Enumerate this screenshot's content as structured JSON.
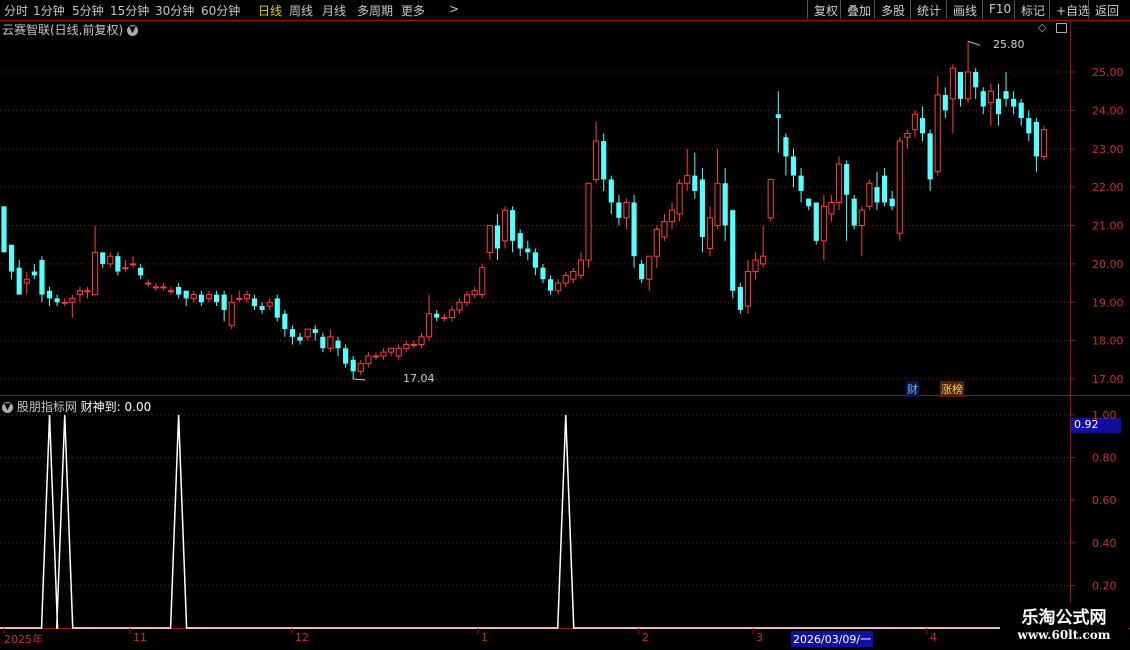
{
  "toolbar": {
    "left_items": [
      "分时",
      "1分钟",
      "5分钟",
      "15分钟",
      "30分钟",
      "60分钟",
      "日线",
      "周线",
      "月线",
      "多周期",
      "更多"
    ],
    "active_index": 6,
    "more_arrow": ">",
    "right_buttons": [
      "复权",
      "叠加",
      "多股",
      "统计",
      "画线",
      "F10",
      "标记",
      "+自选",
      "返回"
    ]
  },
  "main_panel": {
    "title": "云赛智联(日线,前复权)",
    "high_label": "25.80",
    "low_label": "17.04",
    "badge_cai": "财",
    "badge_zhangbang": "涨榜",
    "y_ticks": [
      "25.00",
      "24.00",
      "23.00",
      "22.00",
      "21.00",
      "20.00",
      "19.00",
      "18.00",
      "17.00"
    ]
  },
  "indicator_panel": {
    "title": "股朋指标网",
    "series_label": "财神到:",
    "series_value": "0.00",
    "current_value": "0.92",
    "y_ticks": [
      "1.00",
      "0.80",
      "0.60",
      "0.40",
      "0.20"
    ]
  },
  "x_axis": {
    "labels": [
      "2025年",
      "11",
      "12",
      "1",
      "2",
      "3",
      "4"
    ],
    "cursor_date": "2026/03/09/一"
  },
  "watermark": {
    "line1": "乐淘公式网",
    "line2": "www.60lt.com"
  },
  "colors": {
    "up": "#ff3c3c",
    "down": "#54ffff",
    "grid": "#a01010",
    "line": "#ffffff",
    "active": "#e0d000"
  },
  "chart_data": [
    {
      "type": "candlestick",
      "title": "云赛智联(日线,前复权)",
      "ylim": [
        16.7,
        26.3
      ],
      "high_annotation": 25.8,
      "low_annotation": 17.04,
      "candles": [
        [
          21.5,
          20.3,
          21.0,
          20.5
        ],
        [
          20.5,
          19.8,
          19.6,
          19.9
        ],
        [
          19.9,
          19.2,
          19.4,
          20.1
        ],
        [
          19.5,
          19.6,
          19.2,
          19.8
        ],
        [
          19.8,
          19.7,
          19.6,
          20.0
        ],
        [
          20.1,
          19.2,
          19.0,
          20.2
        ],
        [
          19.3,
          19.1,
          18.9,
          19.4
        ],
        [
          19.1,
          19.0,
          18.9,
          19.2
        ],
        [
          19.0,
          19.0,
          18.9,
          19.1
        ],
        [
          19.0,
          19.1,
          18.6,
          19.2
        ],
        [
          19.2,
          19.3,
          19.0,
          19.4
        ],
        [
          19.3,
          19.3,
          19.1,
          19.4
        ],
        [
          19.2,
          20.3,
          19.2,
          21.0
        ],
        [
          20.3,
          20.0,
          19.9,
          20.3
        ],
        [
          20.0,
          20.2,
          19.9,
          20.3
        ],
        [
          20.2,
          19.8,
          19.7,
          20.3
        ],
        [
          19.9,
          19.9,
          19.8,
          20.1
        ],
        [
          20.0,
          20.0,
          19.9,
          20.2
        ],
        [
          19.9,
          19.7,
          19.6,
          20.0
        ],
        [
          19.5,
          19.5,
          19.4,
          19.6
        ],
        [
          19.4,
          19.4,
          19.3,
          19.5
        ],
        [
          19.4,
          19.4,
          19.3,
          19.5
        ],
        [
          19.3,
          19.3,
          19.2,
          19.4
        ],
        [
          19.4,
          19.2,
          19.1,
          19.5
        ],
        [
          19.3,
          19.1,
          18.9,
          19.3
        ],
        [
          19.1,
          19.2,
          19.0,
          19.3
        ],
        [
          19.2,
          19.0,
          18.9,
          19.3
        ],
        [
          19.1,
          19.2,
          19.0,
          19.3
        ],
        [
          19.2,
          19.0,
          18.9,
          19.3
        ],
        [
          19.2,
          18.8,
          18.5,
          19.3
        ],
        [
          18.4,
          19.0,
          18.3,
          19.2
        ],
        [
          19.1,
          19.1,
          19.0,
          19.3
        ],
        [
          19.1,
          19.2,
          19.0,
          19.3
        ],
        [
          19.1,
          18.9,
          18.8,
          19.2
        ],
        [
          18.9,
          18.8,
          18.7,
          19.0
        ],
        [
          18.9,
          19.0,
          18.8,
          19.1
        ],
        [
          19.1,
          18.6,
          18.5,
          19.2
        ],
        [
          18.7,
          18.3,
          18.1,
          18.8
        ],
        [
          18.3,
          18.1,
          17.9,
          18.4
        ],
        [
          18.1,
          18.0,
          17.9,
          18.2
        ],
        [
          18.1,
          18.3,
          18.0,
          18.3
        ],
        [
          18.3,
          18.2,
          18.0,
          18.4
        ],
        [
          18.1,
          17.8,
          17.7,
          18.2
        ],
        [
          17.8,
          18.1,
          17.7,
          18.3
        ],
        [
          18.0,
          17.8,
          17.6,
          18.1
        ],
        [
          17.8,
          17.4,
          17.3,
          17.9
        ],
        [
          17.5,
          17.2,
          17.0,
          17.6
        ],
        [
          17.2,
          17.4,
          17.1,
          17.5
        ],
        [
          17.4,
          17.6,
          17.3,
          17.7
        ],
        [
          17.6,
          17.6,
          17.5,
          17.7
        ],
        [
          17.6,
          17.7,
          17.5,
          17.8
        ],
        [
          17.7,
          17.8,
          17.6,
          17.8
        ],
        [
          17.6,
          17.8,
          17.5,
          17.9
        ],
        [
          17.8,
          17.9,
          17.7,
          18.0
        ],
        [
          17.9,
          17.9,
          17.8,
          18.0
        ],
        [
          17.9,
          18.1,
          17.8,
          18.2
        ],
        [
          18.1,
          18.7,
          18.0,
          19.2
        ],
        [
          18.7,
          18.6,
          18.5,
          18.8
        ],
        [
          18.6,
          18.6,
          18.5,
          18.7
        ],
        [
          18.6,
          18.8,
          18.5,
          18.9
        ],
        [
          18.8,
          19.0,
          18.7,
          19.1
        ],
        [
          19.0,
          19.2,
          18.9,
          19.3
        ],
        [
          19.2,
          19.3,
          19.1,
          19.4
        ],
        [
          19.2,
          19.9,
          19.1,
          20.0
        ],
        [
          20.3,
          21.0,
          20.1,
          21.0
        ],
        [
          21.0,
          20.4,
          20.1,
          21.3
        ],
        [
          20.6,
          21.4,
          20.4,
          21.5
        ],
        [
          21.4,
          20.6,
          20.3,
          21.5
        ],
        [
          20.8,
          20.4,
          20.2,
          20.9
        ],
        [
          20.4,
          20.3,
          20.1,
          20.6
        ],
        [
          20.3,
          19.9,
          19.7,
          20.4
        ],
        [
          19.9,
          19.6,
          19.5,
          20.0
        ],
        [
          19.6,
          19.3,
          19.2,
          19.7
        ],
        [
          19.3,
          19.5,
          19.2,
          19.6
        ],
        [
          19.5,
          19.7,
          19.4,
          19.8
        ],
        [
          19.6,
          19.8,
          19.5,
          19.9
        ],
        [
          19.7,
          20.1,
          19.6,
          20.3
        ],
        [
          20.1,
          22.1,
          19.9,
          22.1
        ],
        [
          22.2,
          23.2,
          22.1,
          23.7
        ],
        [
          23.2,
          22.2,
          21.9,
          23.4
        ],
        [
          22.2,
          21.6,
          21.3,
          22.3
        ],
        [
          21.6,
          21.2,
          21.0,
          21.8
        ],
        [
          21.2,
          21.6,
          20.9,
          21.7
        ],
        [
          21.6,
          20.2,
          19.9,
          21.8
        ],
        [
          20.0,
          19.6,
          19.5,
          20.1
        ],
        [
          19.6,
          20.2,
          19.3,
          20.2
        ],
        [
          20.2,
          20.9,
          19.9,
          21.0
        ],
        [
          20.7,
          21.1,
          20.6,
          21.3
        ],
        [
          21.1,
          21.4,
          20.9,
          21.6
        ],
        [
          21.3,
          22.1,
          21.1,
          22.2
        ],
        [
          22.1,
          22.3,
          21.9,
          23.0
        ],
        [
          22.3,
          21.9,
          21.7,
          22.9
        ],
        [
          22.2,
          20.7,
          20.3,
          22.5
        ],
        [
          20.4,
          21.2,
          20.2,
          21.5
        ],
        [
          21.0,
          22.1,
          20.9,
          23.0
        ],
        [
          22.1,
          21.0,
          20.6,
          22.5
        ],
        [
          21.4,
          19.3,
          19.1,
          21.4
        ],
        [
          19.4,
          18.8,
          18.7,
          19.5
        ],
        [
          18.9,
          19.8,
          18.7,
          20.1
        ],
        [
          19.8,
          20.1,
          19.6,
          20.3
        ],
        [
          20.0,
          20.2,
          19.9,
          21.0
        ],
        [
          21.2,
          22.2,
          21.1,
          22.2
        ],
        [
          23.9,
          23.8,
          22.9,
          24.5
        ],
        [
          23.3,
          22.8,
          22.3,
          23.4
        ],
        [
          22.8,
          22.3,
          22.0,
          23.0
        ],
        [
          22.3,
          21.9,
          21.6,
          22.5
        ],
        [
          21.7,
          21.5,
          21.4,
          21.7
        ],
        [
          21.6,
          20.6,
          20.5,
          21.6
        ],
        [
          20.6,
          21.5,
          20.1,
          21.8
        ],
        [
          21.3,
          21.6,
          21.1,
          21.8
        ],
        [
          21.6,
          22.6,
          21.4,
          22.8
        ],
        [
          22.6,
          21.8,
          20.6,
          22.7
        ],
        [
          21.7,
          21.0,
          20.9,
          21.8
        ],
        [
          21.0,
          21.4,
          20.2,
          21.5
        ],
        [
          21.5,
          22.1,
          21.4,
          22.2
        ],
        [
          22.0,
          21.6,
          21.4,
          22.4
        ],
        [
          22.3,
          21.6,
          21.5,
          22.5
        ],
        [
          21.7,
          21.5,
          21.4,
          21.9
        ],
        [
          20.8,
          23.2,
          20.6,
          23.3
        ],
        [
          23.3,
          23.4,
          23.0,
          23.5
        ],
        [
          23.5,
          23.9,
          23.3,
          24.0
        ],
        [
          23.8,
          23.4,
          23.2,
          24.1
        ],
        [
          23.4,
          22.2,
          21.9,
          23.5
        ],
        [
          22.4,
          24.4,
          22.3,
          24.9
        ],
        [
          24.4,
          24.0,
          23.8,
          24.6
        ],
        [
          24.3,
          25.1,
          23.4,
          25.2
        ],
        [
          25.0,
          24.3,
          24.1,
          25.0
        ],
        [
          24.3,
          25.0,
          24.2,
          25.8
        ],
        [
          25.0,
          24.6,
          24.3,
          25.1
        ],
        [
          24.5,
          24.1,
          23.9,
          24.6
        ],
        [
          24.2,
          24.5,
          23.6,
          24.7
        ],
        [
          24.3,
          23.9,
          23.6,
          24.7
        ],
        [
          24.5,
          24.3,
          24.1,
          25.0
        ],
        [
          24.3,
          24.1,
          23.9,
          24.5
        ],
        [
          24.2,
          23.8,
          23.6,
          24.3
        ],
        [
          23.8,
          23.4,
          23.2,
          24.0
        ],
        [
          23.7,
          22.8,
          22.4,
          23.8
        ],
        [
          22.8,
          23.5,
          22.7,
          23.6
        ]
      ]
    },
    {
      "type": "line",
      "title": "财神到",
      "ylim": [
        0,
        1.05
      ],
      "spikes": [
        {
          "index": 6,
          "value": 1.0
        },
        {
          "index": 8,
          "value": 1.0
        },
        {
          "index": 23,
          "value": 1.0
        },
        {
          "index": 74,
          "value": 1.0
        }
      ],
      "baseline": 0.0,
      "last_value": 0.0
    }
  ]
}
